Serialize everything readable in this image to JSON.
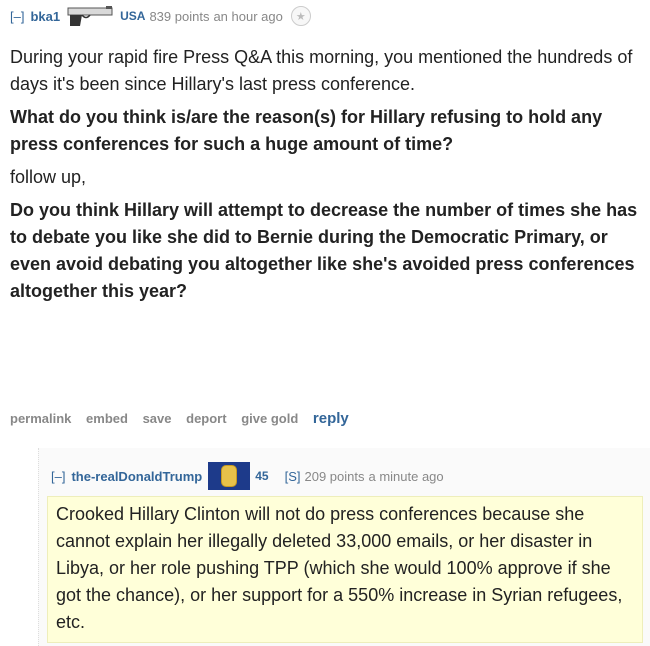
{
  "parent": {
    "toggle": "[–]",
    "author": "bka1",
    "flair_text": "USA",
    "score": "839 points",
    "time": "an hour ago",
    "icons": {
      "flair": "pistol-icon",
      "gild": "star-icon"
    },
    "paragraphs": [
      "During your rapid fire Press Q&A this morning, you mentioned the hundreds of days it's been since Hillary's last press conference.",
      "What do you think is/are the reason(s) for Hillary refusing to hold any press conferences for such a huge amount of time?",
      "follow up,",
      "Do you think Hillary will attempt to decrease the number of times she has to debate you like she did to Bernie during the Democratic Primary, or even avoid debating you altogether like she's avoided press conferences altogether this year?"
    ],
    "buttons": {
      "permalink": "permalink",
      "embed": "embed",
      "save": "save",
      "report": "deport",
      "give_gold": "give gold",
      "reply": "reply"
    }
  },
  "child": {
    "toggle": "[–]",
    "author": "the-realDonaldTrump",
    "flair_text": "45",
    "submitter_tag": "[S]",
    "score": "209 points",
    "time": "a minute ago",
    "icons": {
      "flair": "new-york-flag-icon"
    },
    "body": "Crooked Hillary Clinton will not do press conferences because she cannot explain her illegally deleted 33,000 emails, or her disaster in Libya, or her role pushing TPP (which she would 100% approve if she got the chance), or her support for a 550% increase in Syrian refugees, etc.",
    "colors": {
      "highlight": "#ffffd9",
      "link": "#336699"
    }
  }
}
